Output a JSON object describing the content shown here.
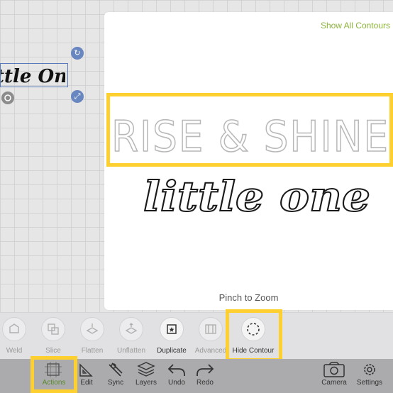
{
  "canvas": {
    "preview_text": "ttle One",
    "rotate_handle": "↻",
    "scale_handle": "⤢"
  },
  "contour_panel": {
    "show_all_label": "Show All Contours",
    "design_line1": "RISE & SHINE",
    "design_line2": "little one",
    "hint": "Pinch to Zoom"
  },
  "tools": [
    {
      "label": "Weld",
      "icon": "weld-icon",
      "state": "disabled"
    },
    {
      "label": "Slice",
      "icon": "slice-icon",
      "state": "disabled"
    },
    {
      "label": "Flatten",
      "icon": "flatten-icon",
      "state": "disabled"
    },
    {
      "label": "Unflatten",
      "icon": "unflatten-icon",
      "state": "disabled"
    },
    {
      "label": "Duplicate",
      "icon": "duplicate-icon",
      "state": "enabled"
    },
    {
      "label": "Advanced",
      "icon": "advanced-icon",
      "state": "disabled"
    },
    {
      "label": "Hide Contour",
      "icon": "hide-contour-icon",
      "state": "selected"
    }
  ],
  "bottom_nav": [
    {
      "label": "Actions",
      "icon": "actions-icon",
      "state": "selected"
    },
    {
      "label": "Edit",
      "icon": "edit-icon"
    },
    {
      "label": "Sync",
      "icon": "sync-icon"
    },
    {
      "label": "Layers",
      "icon": "layers-icon"
    },
    {
      "label": "Undo",
      "icon": "undo-icon"
    },
    {
      "label": "Redo",
      "icon": "redo-icon"
    },
    {
      "label": "Camera",
      "icon": "camera-icon"
    },
    {
      "label": "Settings",
      "icon": "settings-icon"
    }
  ],
  "colors": {
    "highlight": "#fdd02f",
    "accent_green": "#8cb43a",
    "selection_blue": "#5b7ab8"
  }
}
